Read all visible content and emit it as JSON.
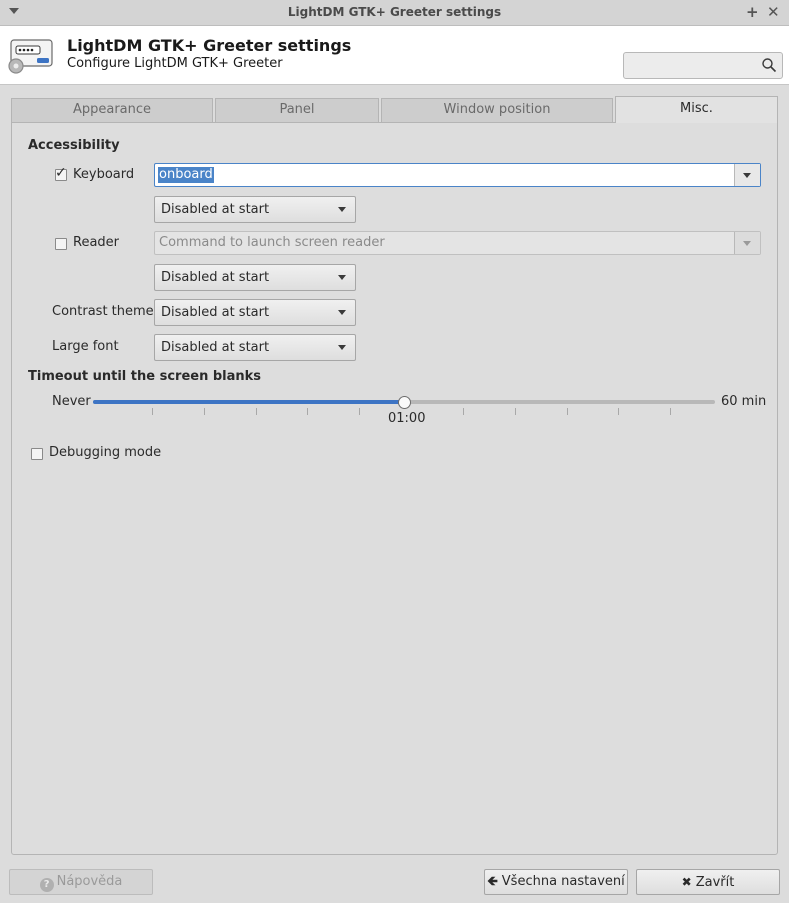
{
  "window": {
    "title": "LightDM GTK+ Greeter settings"
  },
  "header": {
    "app_title": "LightDM GTK+ Greeter settings",
    "app_subtitle": "Configure LightDM GTK+ Greeter",
    "search_value": ""
  },
  "tabs": [
    {
      "label": "Appearance",
      "active": false
    },
    {
      "label": "Panel",
      "active": false
    },
    {
      "label": "Window position",
      "active": false
    },
    {
      "label": "Misc.",
      "active": true
    }
  ],
  "accessibility": {
    "heading": "Accessibility",
    "keyboard": {
      "label": "Keyboard",
      "checked": true,
      "command_value": "onboard",
      "start_state": "Disabled at start"
    },
    "reader": {
      "label": "Reader",
      "checked": false,
      "command_placeholder": "Command to launch screen reader",
      "start_state": "Disabled at start"
    },
    "contrast_theme": {
      "label": "Contrast theme",
      "start_state": "Disabled at start"
    },
    "large_font": {
      "label": "Large font",
      "start_state": "Disabled at start"
    }
  },
  "timeout": {
    "heading": "Timeout until the screen blanks",
    "min_label": "Never",
    "max_label": "60 min",
    "value_label": "01:00",
    "value_fraction": 0.5
  },
  "debugging": {
    "label": "Debugging mode",
    "checked": false
  },
  "footer": {
    "help_label": "Nápověda",
    "all_settings_label": "Všechna nastavení",
    "close_label": "Zavřít"
  },
  "colors": {
    "accent": "#3d74c4",
    "selection": "#4a84c8"
  }
}
